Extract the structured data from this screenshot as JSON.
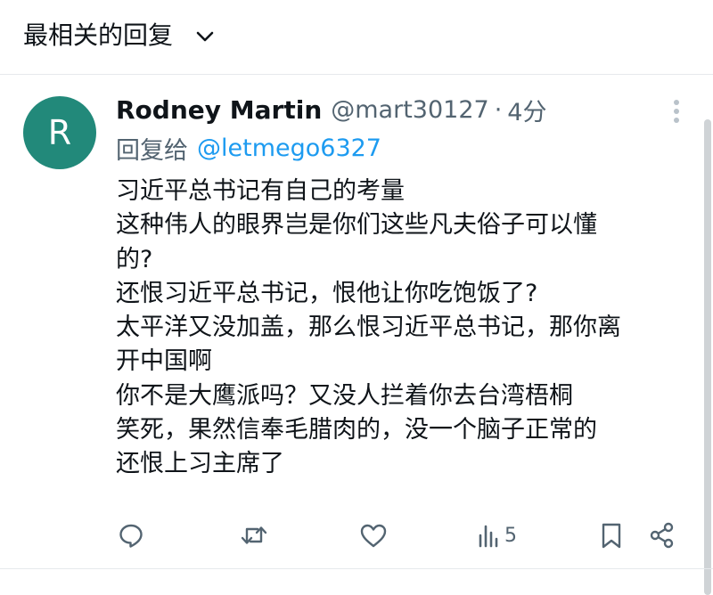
{
  "sort": {
    "label": "最相关的回复"
  },
  "reply": {
    "avatar_letter": "R",
    "avatar_color": "#22897a",
    "display_name": "Rodney Martin",
    "handle": "@mart30127",
    "separator": "·",
    "time": "4分",
    "reply_to_label": "回复给",
    "reply_to_handle": "@letmego6327",
    "text_lines": [
      "习近平总书记有自己的考量",
      "这种伟人的眼界岂是你们这些凡夫俗子可以懂",
      "的?",
      "还恨习近平总书记，恨他让你吃饱饭了?",
      "太平洋又没加盖，那么恨习近平总书记，那你离",
      "开中国啊",
      "你不是大鹰派吗？又没人拦着你去台湾梧桐",
      "笑死，果然信奉毛腊肉的，没一个脑子正常的",
      "还恨上习主席了"
    ],
    "actions": {
      "reply_icon": "reply-icon",
      "retweet_icon": "retweet-icon",
      "like_icon": "heart-icon",
      "views_icon": "views-icon",
      "views_count": "5",
      "bookmark_icon": "bookmark-icon",
      "share_icon": "share-icon"
    }
  },
  "colors": {
    "text": "#0f1419",
    "muted": "#536471",
    "link": "#1d9bf0",
    "icon": "#536471"
  }
}
